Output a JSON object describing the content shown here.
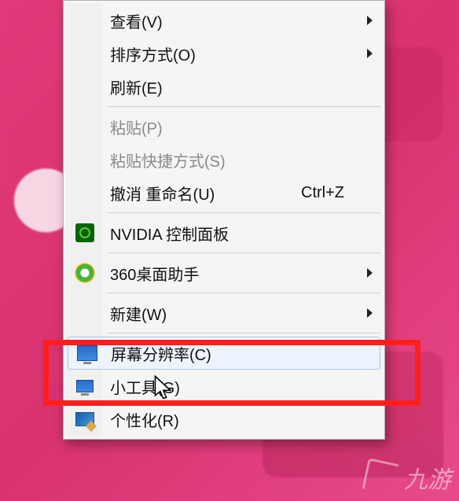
{
  "menu": {
    "items": [
      {
        "label": "查看(V)",
        "submenu": true
      },
      {
        "label": "排序方式(O)",
        "submenu": true
      },
      {
        "label": "刷新(E)"
      }
    ],
    "items2": [
      {
        "label": "粘贴(P)",
        "disabled": true
      },
      {
        "label": "粘贴快捷方式(S)",
        "disabled": true
      },
      {
        "label": "撤消 重命名(U)",
        "shortcut": "Ctrl+Z"
      }
    ],
    "nvidia_label": "NVIDIA 控制面板",
    "helper360_label": "360桌面助手",
    "new_label": "新建(W)",
    "resolution_label": "屏幕分辨率(C)",
    "gadgets_label": "小工具(G)",
    "personalize_label": "个性化(R)"
  },
  "watermark_text": "九游"
}
